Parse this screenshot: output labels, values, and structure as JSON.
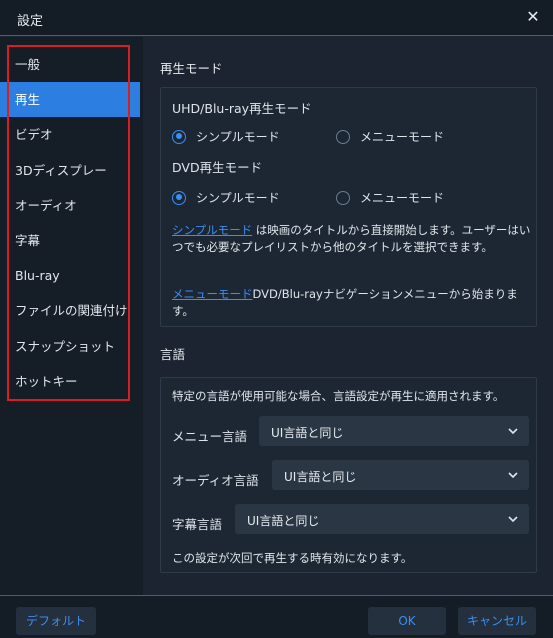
{
  "window": {
    "title": "設定"
  },
  "sidebar": {
    "items": [
      {
        "label": "一般"
      },
      {
        "label": "再生"
      },
      {
        "label": "ビデオ"
      },
      {
        "label": "3Dディスプレー"
      },
      {
        "label": "オーディオ"
      },
      {
        "label": "字幕"
      },
      {
        "label": "Blu-ray"
      },
      {
        "label": "ファイルの関連付け"
      },
      {
        "label": "スナップショット"
      },
      {
        "label": "ホットキー"
      }
    ],
    "active_index": 1
  },
  "playback": {
    "section_title": "再生モード",
    "uhd_label": "UHD/Blu-ray再生モード",
    "uhd_simple": "シンプルモード",
    "uhd_menu": "メニューモード",
    "dvd_label": "DVD再生モード",
    "dvd_simple": "シンプルモード",
    "dvd_menu": "メニューモード",
    "simple_link": "シンプルモード",
    "simple_desc": " は映画のタイトルから直接開始します。ユーザーはいつでも必要なプレイリストから他のタイトルを選択できます。",
    "menu_link": "メニューモード",
    "menu_desc": "DVD/Blu-rayナビゲーションメニューから始まります。"
  },
  "language": {
    "section_title": "言語",
    "intro": "特定の言語が使用可能な場合、言語設定が再生に適用されます。",
    "menu_label": "メニュー言語",
    "menu_value": "UI言語と同じ",
    "audio_label": "オーディオ言語",
    "audio_value": "UI言語と同じ",
    "subtitle_label": "字幕言語",
    "subtitle_value": "UI言語と同じ",
    "note": "この設定が次回で再生する時有効になります。"
  },
  "footer": {
    "default_label": "デフォルト",
    "ok_label": "OK",
    "cancel_label": "キャンセル"
  },
  "colors": {
    "accent": "#2c7fe0",
    "highlight_border": "#d81e1e"
  }
}
